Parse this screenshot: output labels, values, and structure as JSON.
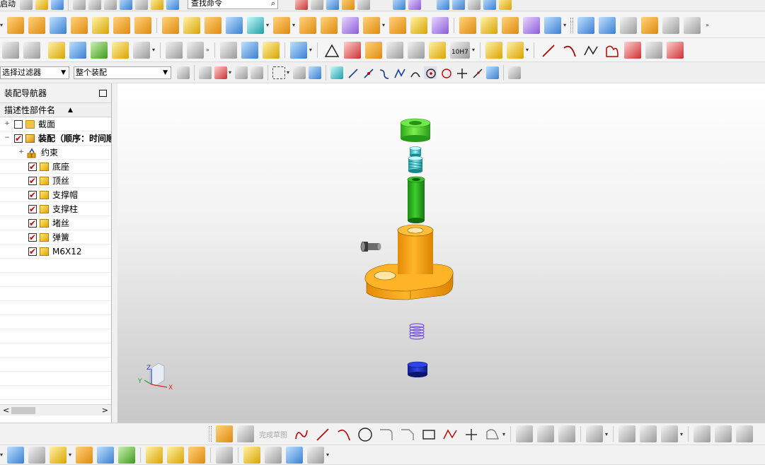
{
  "toolbar_row1": {
    "left_label": "启动",
    "command_search_placeholder": "查找命令"
  },
  "selection_bar": {
    "filter_value": "选择过滤器",
    "scope_value": "整个装配",
    "snap_label": "10H7"
  },
  "assembly_navigator": {
    "title": "装配导航器",
    "column_header": "描述性部件名",
    "nodes": [
      {
        "label": "截面",
        "checked": false,
        "icon": "folder-icon"
      },
      {
        "label": "装配（顺序：时间顺序）",
        "checked": true,
        "icon": "assembly-icon",
        "bold": true
      },
      {
        "label": "约束",
        "icon": "constraint-icon"
      },
      {
        "label": "底座",
        "checked": true,
        "icon": "part-icon"
      },
      {
        "label": "顶丝",
        "checked": true,
        "icon": "part-icon"
      },
      {
        "label": "支撑帽",
        "checked": true,
        "icon": "part-icon"
      },
      {
        "label": "支撑柱",
        "checked": true,
        "icon": "part-icon"
      },
      {
        "label": "堵丝",
        "checked": true,
        "icon": "part-icon"
      },
      {
        "label": "弹簧",
        "checked": true,
        "icon": "part-icon"
      },
      {
        "label": "M6X12",
        "checked": true,
        "icon": "part-icon"
      }
    ]
  },
  "triad": {
    "x": "X",
    "y": "Y",
    "z": "Z"
  },
  "sketch_toolbar": {
    "finish_sketch": "完成草图"
  },
  "colors": {
    "base_orange": "#f5a20f",
    "cap_green": "#3fd21c",
    "column_green": "#27a61e",
    "screw_teal": "#2cc8d0",
    "spring_purple": "#7b55e0",
    "plug_blue": "#1d2fbf",
    "bolt_gray": "#6a6a6a"
  }
}
